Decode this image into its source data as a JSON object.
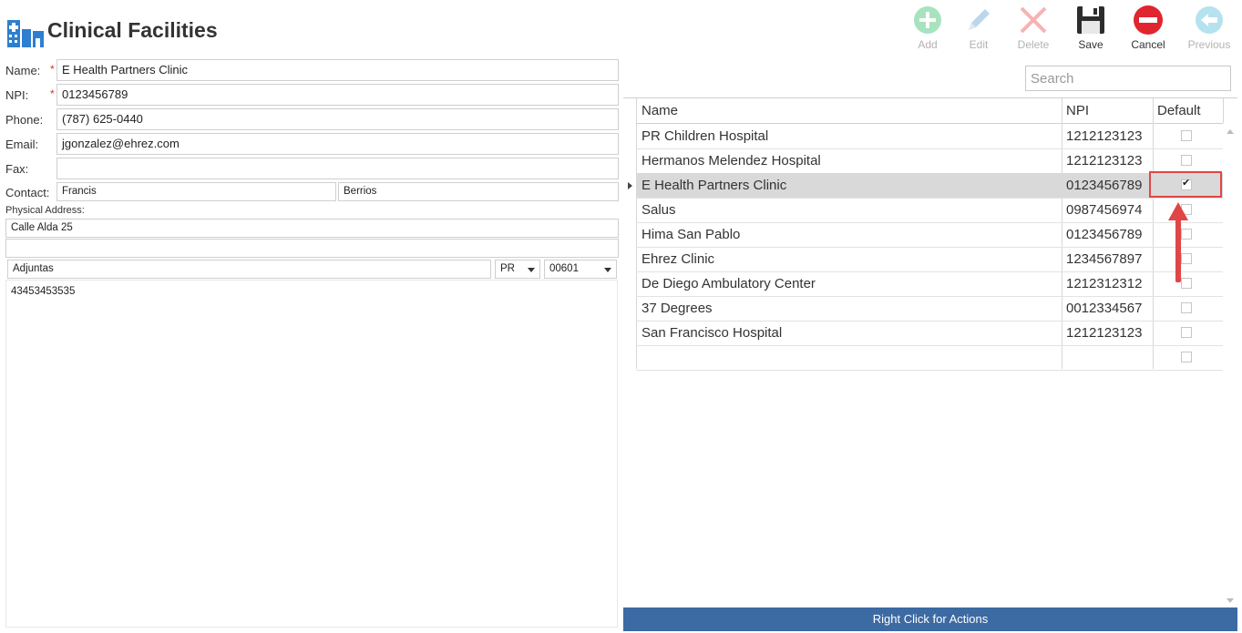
{
  "header": {
    "title": "Clinical Facilities",
    "logo_icon": "hospital-icon"
  },
  "toolbar": {
    "add_label": "Add",
    "edit_label": "Edit",
    "delete_label": "Delete",
    "save_label": "Save",
    "cancel_label": "Cancel",
    "previous_label": "Previous"
  },
  "form": {
    "name_label": "Name:",
    "npi_label": "NPI:",
    "phone_label": "Phone:",
    "email_label": "Email:",
    "fax_label": "Fax:",
    "contact_label": "Contact:",
    "address_label": "Physical Address:",
    "required_mark": "*",
    "name_value": "E Health Partners Clinic",
    "npi_value": "0123456789",
    "phone_value": "(787) 625-0440",
    "email_value": "jgonzalez@ehrez.com",
    "fax_value": "",
    "contact_first": "Francis",
    "contact_last": "Berrios",
    "address_line1": "Calle Alda 25",
    "address_line2": "",
    "city": "Adjuntas",
    "state": "PR",
    "zip": "00601",
    "notes": "43453453535"
  },
  "search": {
    "placeholder": "Search"
  },
  "grid": {
    "columns": [
      "Name",
      "NPI",
      "Default"
    ],
    "rows": [
      {
        "name": "PR Children Hospital",
        "npi": "1212123123",
        "default": false
      },
      {
        "name": "Hermanos Melendez Hospital",
        "npi": "1212123123",
        "default": false
      },
      {
        "name": "E Health Partners Clinic",
        "npi": "0123456789",
        "default": true
      },
      {
        "name": "Salus",
        "npi": "0987456974",
        "default": false
      },
      {
        "name": "Hima San Pablo",
        "npi": "0123456789",
        "default": false
      },
      {
        "name": "Ehrez  Clinic",
        "npi": "1234567897",
        "default": false
      },
      {
        "name": "De Diego Ambulatory Center",
        "npi": "1212312312",
        "default": false
      },
      {
        "name": "37 Degrees",
        "npi": "0012334567",
        "default": false
      },
      {
        "name": "San Francisco Hospital",
        "npi": "1212123123",
        "default": false
      },
      {
        "name": "",
        "npi": "",
        "default": false
      }
    ],
    "selected_index": 2
  },
  "footer": {
    "label": "Right Click for Actions"
  },
  "colors": {
    "accent": "#3c6aa3",
    "highlight": "#e04646",
    "add": "#7ed6a2",
    "delete": "#f59a9a",
    "save": "#2b2b2b",
    "cancel": "#e0252f"
  }
}
